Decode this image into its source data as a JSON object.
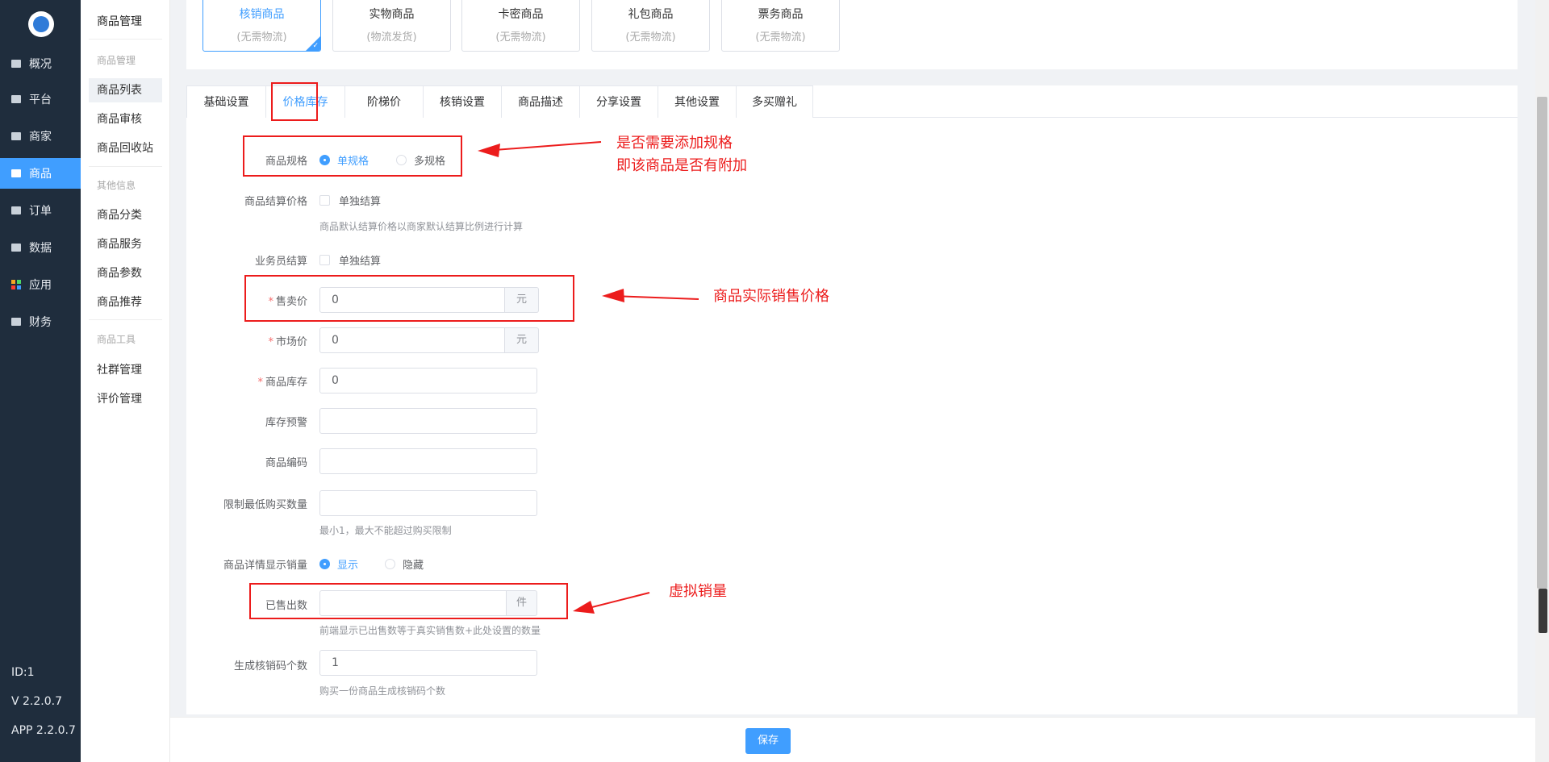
{
  "sidebar": {
    "items": [
      {
        "label": "概况",
        "icon": "overview-icon"
      },
      {
        "label": "平台",
        "icon": "monitor-icon"
      },
      {
        "label": "商家",
        "icon": "store-icon"
      },
      {
        "label": "商品",
        "icon": "goods-icon"
      },
      {
        "label": "订单",
        "icon": "order-icon"
      },
      {
        "label": "数据",
        "icon": "chart-icon"
      },
      {
        "label": "应用",
        "icon": "apps-icon"
      },
      {
        "label": "财务",
        "icon": "finance-icon"
      }
    ],
    "active_index": 3,
    "id_text": "ID:1",
    "version": "V 2.2.0.7",
    "app_version": "APP 2.2.0.7"
  },
  "submenu": {
    "title": "商品管理",
    "group1": "商品管理",
    "items1": [
      "商品列表",
      "商品审核",
      "商品回收站"
    ],
    "group2": "其他信息",
    "items2": [
      "商品分类",
      "商品服务",
      "商品参数",
      "商品推荐"
    ],
    "group3": "商品工具",
    "items3": [
      "社群管理",
      "评价管理"
    ]
  },
  "product_types": [
    {
      "name": "核销商品",
      "sub": "(无需物流)"
    },
    {
      "name": "实物商品",
      "sub": "(物流发货)"
    },
    {
      "name": "卡密商品",
      "sub": "(无需物流)"
    },
    {
      "name": "礼包商品",
      "sub": "(无需物流)"
    },
    {
      "name": "票务商品",
      "sub": "(无需物流)"
    }
  ],
  "tabs": [
    "基础设置",
    "价格库存",
    "阶梯价",
    "核销设置",
    "商品描述",
    "分享设置",
    "其他设置",
    "多买赠礼"
  ],
  "form": {
    "spec": {
      "label": "商品规格",
      "opt1": "单规格",
      "opt2": "多规格"
    },
    "settle": {
      "label": "商品结算价格",
      "check": "单独结算",
      "hint": "商品默认结算价格以商家默认结算比例进行计算"
    },
    "staff": {
      "label": "业务员结算",
      "check": "单独结算"
    },
    "price": {
      "label": "售卖价",
      "value": "0",
      "unit": "元"
    },
    "market": {
      "label": "市场价",
      "value": "0",
      "unit": "元"
    },
    "stock": {
      "label": "商品库存",
      "value": "0"
    },
    "warn": {
      "label": "库存预警",
      "value": ""
    },
    "code": {
      "label": "商品编码",
      "value": ""
    },
    "minbuy": {
      "label": "限制最低购买数量",
      "value": "",
      "hint": "最小1，最大不能超过购买限制"
    },
    "showsales": {
      "label": "商品详情显示销量",
      "opt1": "显示",
      "opt2": "隐藏"
    },
    "sold": {
      "label": "已售出数",
      "value": "",
      "unit": "件",
      "hint": "前端显示已出售数等于真实销售数+此处设置的数量"
    },
    "codes": {
      "label": "生成核销码个数",
      "value": "1",
      "hint": "购买一份商品生成核销码个数"
    }
  },
  "annotations": {
    "spec_line1": "是否需要添加规格",
    "spec_line2": "即该商品是否有附加",
    "price": "商品实际销售价格",
    "sold": "虚拟销量"
  },
  "footer": {
    "save": "保存"
  },
  "colors": {
    "accent": "#409eff",
    "sidebar": "#1f2d3d",
    "annotation": "#ec1c1c"
  }
}
